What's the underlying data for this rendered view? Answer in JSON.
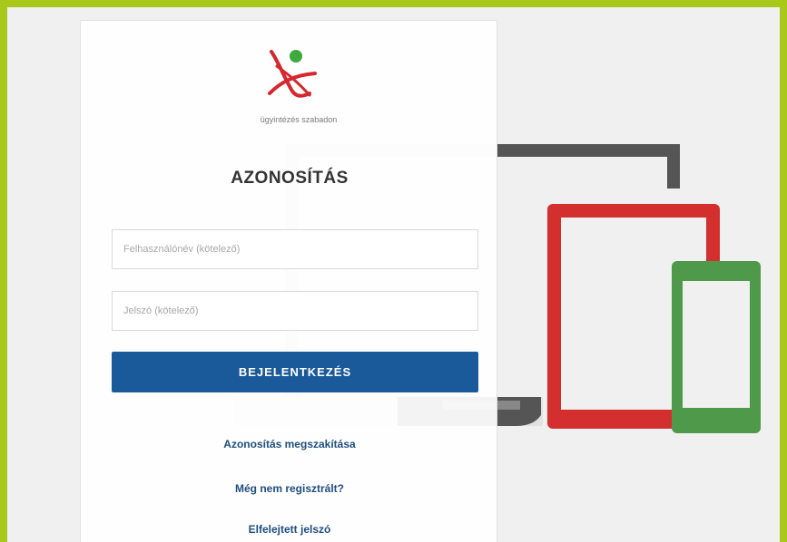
{
  "logo": {
    "tagline": "ügyintézés szabadon",
    "mark_colors": {
      "red": "#d6262e",
      "green": "#3daa3d"
    }
  },
  "login": {
    "title": "AZONOSÍTÁS",
    "username_placeholder": "Felhasználónév (kötelező)",
    "password_placeholder": "Jelszó (kötelező)",
    "submit_label": "BEJELENTKEZÉS"
  },
  "links": {
    "cancel": "Azonosítás megszakítása",
    "register": "Még nem regisztrált?",
    "forgot_password": "Elfelejtett jelszó"
  },
  "colors": {
    "accent": "#1a5a9a",
    "border": "#a9c81a",
    "device_dark": "#555555",
    "device_red": "#d32f2f",
    "device_green": "#4e9a4a"
  }
}
